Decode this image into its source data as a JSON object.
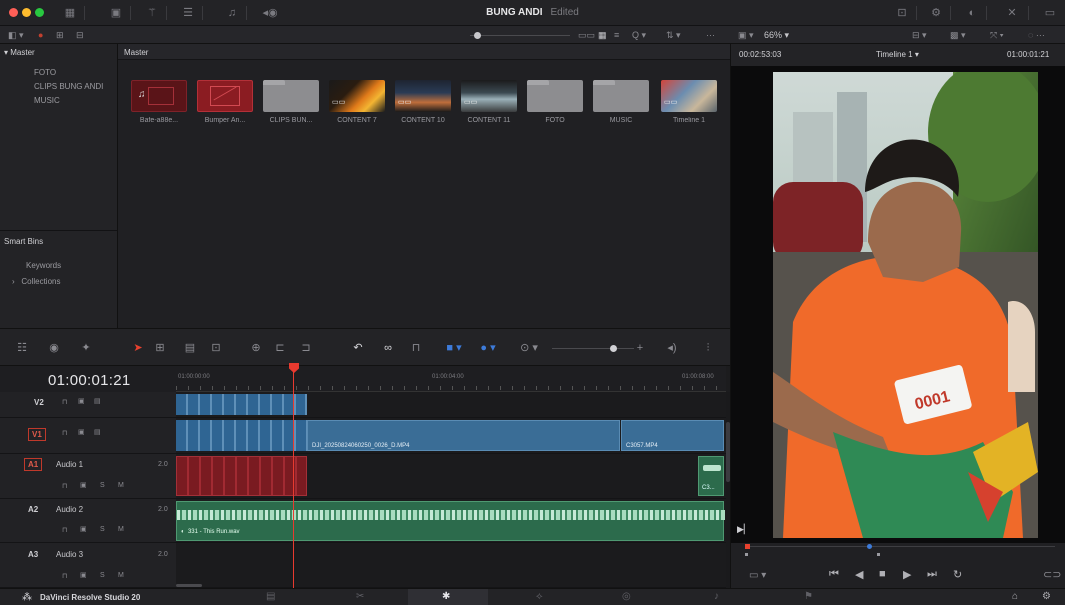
{
  "window": {
    "title": "BUNG ANDI",
    "status": "Edited"
  },
  "toolbar2": {
    "search_glyph": "Q",
    "more": "···"
  },
  "viewer": {
    "timecode_left": "00:02:53:03",
    "zoom": "66%",
    "timeline_name": "Timeline 1",
    "timecode_right": "01:00:01:21"
  },
  "bins": {
    "master_label": "Master",
    "master_children": [
      "FOTO",
      "CLIPS BUNG ANDI",
      "MUSIC"
    ],
    "smart_bins_label": "Smart Bins",
    "smart_children": [
      "Keywords",
      "Collections"
    ]
  },
  "media": {
    "header": "Master",
    "clips": [
      {
        "name": "Bafe-a88e...",
        "kind": "audio-red"
      },
      {
        "name": "Bumper An...",
        "kind": "red"
      },
      {
        "name": "CLIPS BUN...",
        "kind": "folder"
      },
      {
        "name": "CONTENT 7",
        "kind": "video-orange"
      },
      {
        "name": "CONTENT 10",
        "kind": "video-dark"
      },
      {
        "name": "CONTENT 11",
        "kind": "video-dark2"
      },
      {
        "name": "FOTO",
        "kind": "folder"
      },
      {
        "name": "MUSIC",
        "kind": "folder"
      },
      {
        "name": "Timeline 1",
        "kind": "timeline"
      }
    ]
  },
  "timeline": {
    "timecode": "01:00:01:21",
    "ruler": [
      "01:00:00:00",
      "01:00:04:00",
      "01:00:08:00"
    ],
    "tracks": [
      {
        "id": "V2",
        "name": ""
      },
      {
        "id": "V1",
        "name": ""
      },
      {
        "id": "A1",
        "name": "Audio 1",
        "ch": "2.0"
      },
      {
        "id": "A2",
        "name": "Audio 2",
        "ch": "2.0"
      },
      {
        "id": "A3",
        "name": "Audio 3",
        "ch": "2.0"
      }
    ],
    "clips": {
      "v1_main": "DJI_20250824060250_0026_D.MP4",
      "v1_end": "C3057.MP4",
      "a1_end": "C3...",
      "a2_music": "331 - This Run.wav"
    }
  },
  "footer": {
    "app_name": "DaVinci Resolve Studio 20"
  },
  "colors": {
    "accent": "#e8412e",
    "video_clip": "#3a6d96",
    "audio_red": "#7a1b21",
    "audio_green": "#2c6b4c",
    "playhead": "#e83a2f"
  }
}
